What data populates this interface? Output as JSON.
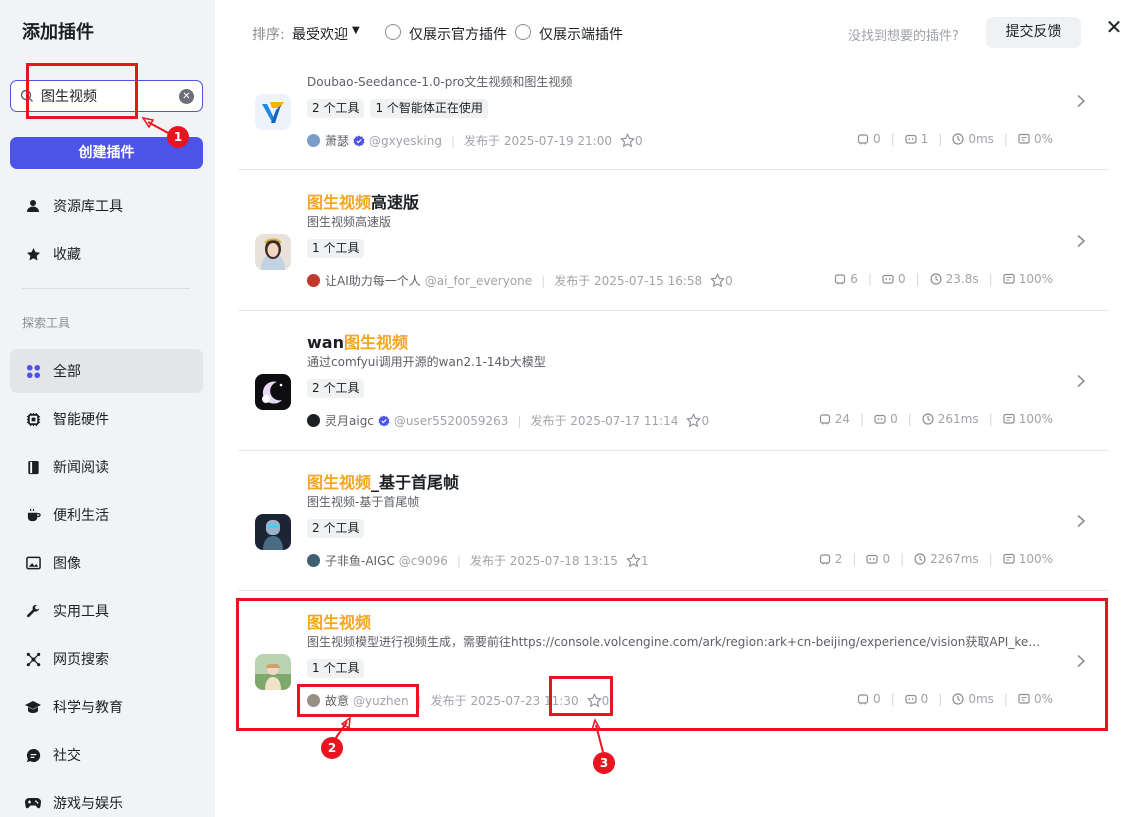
{
  "sidebar": {
    "title": "添加插件",
    "search": {
      "value": "图生视频",
      "placeholder": ""
    },
    "create_button": "创建插件",
    "top_items": [
      {
        "label": "资源库工具",
        "icon": "user-icon"
      },
      {
        "label": "收藏",
        "icon": "star-icon"
      }
    ],
    "section_label": "探索工具",
    "categories": [
      {
        "label": "全部",
        "icon": "grid-icon",
        "active": true
      },
      {
        "label": "智能硬件",
        "icon": "chip-icon"
      },
      {
        "label": "新闻阅读",
        "icon": "book-icon"
      },
      {
        "label": "便利生活",
        "icon": "cup-icon"
      },
      {
        "label": "图像",
        "icon": "image-icon"
      },
      {
        "label": "实用工具",
        "icon": "wrench-icon"
      },
      {
        "label": "网页搜索",
        "icon": "network-icon"
      },
      {
        "label": "科学与教育",
        "icon": "graduation-icon"
      },
      {
        "label": "社交",
        "icon": "chat-icon"
      },
      {
        "label": "游戏与娱乐",
        "icon": "gamepad-icon"
      }
    ]
  },
  "topbar": {
    "sort_label": "排序:",
    "sort_value": "最受欢迎",
    "filter_official": "仅展示官方插件",
    "filter_device": "仅展示端插件",
    "not_found_text": "没找到想要的插件?",
    "feedback_button": "提交反馈"
  },
  "plugins": [
    {
      "title_hl": "",
      "title_rest": "",
      "desc": "Doubao-Seedance-1.0-pro文生视频和图生视频",
      "tags": [
        "2 个工具",
        "1 个智能体正在使用"
      ],
      "author": "萧瑟",
      "handle": "@gxyesking",
      "verified": true,
      "published": "发布于 2025-07-19 21:00",
      "stars": "0",
      "calls": "0",
      "bots": "1",
      "latency": "0ms",
      "success": "0%"
    },
    {
      "title_hl": "图生视频",
      "title_rest": "高速版",
      "desc": "图生视频高速版",
      "tags": [
        "1 个工具"
      ],
      "author": "让AI助力每一个人",
      "handle": "@ai_for_everyone",
      "verified": false,
      "published": "发布于 2025-07-15 16:58",
      "stars": "0",
      "calls": "6",
      "bots": "0",
      "latency": "23.8s",
      "success": "100%"
    },
    {
      "title_pre": "wan",
      "title_hl": "图生视频",
      "title_rest": "",
      "desc": "通过comfyui调用开源的wan2.1-14b大模型",
      "tags": [
        "2 个工具"
      ],
      "author": "灵月aigc",
      "handle": "@user5520059263",
      "verified": true,
      "published": "发布于 2025-07-17 11:14",
      "stars": "0",
      "calls": "24",
      "bots": "0",
      "latency": "261ms",
      "success": "100%"
    },
    {
      "title_hl": "图生视频",
      "title_rest": "_基于首尾帧",
      "desc": "图生视频-基于首尾帧",
      "tags": [
        "2 个工具"
      ],
      "author": "子非鱼-AIGC",
      "handle": "@c9096",
      "verified": false,
      "published": "发布于 2025-07-18 13:15",
      "stars": "1",
      "calls": "2",
      "bots": "0",
      "latency": "2267ms",
      "success": "100%"
    },
    {
      "title_hl": "图生视频",
      "title_rest": "",
      "desc": "图生视频模型进行视频生成，需要前往https://console.volcengine.com/ark/region:ark+cn-beijing/experience/vision获取API_key和…",
      "tags": [
        "1 个工具"
      ],
      "author": "故意",
      "handle": "@yuzhen",
      "verified": false,
      "published": "发布于 2025-07-23 11:30",
      "stars": "0",
      "calls": "0",
      "bots": "0",
      "latency": "0ms",
      "success": "0%"
    }
  ],
  "annotations": [
    "1",
    "2",
    "3"
  ],
  "colors": {
    "accent": "#4d53e8",
    "highlight": "#f5a623",
    "annotation": "#e8141f"
  }
}
